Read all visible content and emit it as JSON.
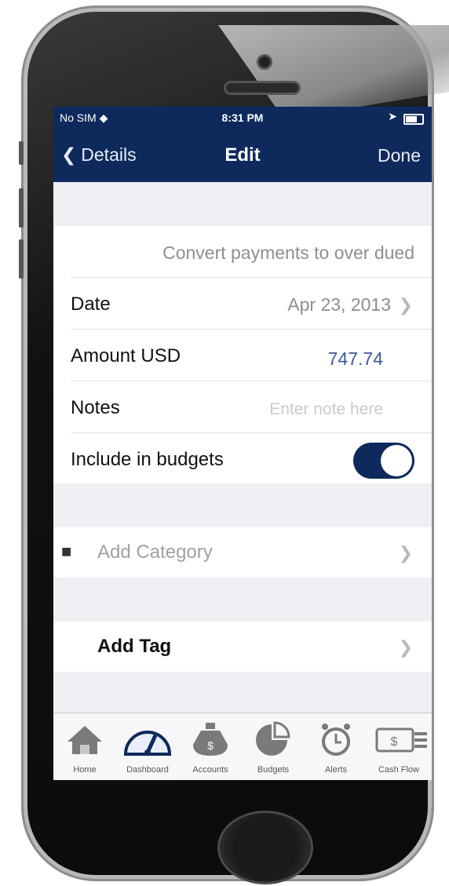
{
  "status_bar": {
    "carrier": "No SIM",
    "time": "8:31 PM"
  },
  "nav": {
    "back_label": "Details",
    "title": "Edit",
    "done_label": "Done"
  },
  "form": {
    "description": "Convert payments to over dued",
    "date_label": "Date",
    "date_value": "Apr 23, 2013",
    "amount_label": "Amount USD",
    "amount_value": "747.74",
    "notes_label": "Notes",
    "notes_placeholder": "Enter note here",
    "budgets_label": "Include in budgets",
    "budgets_on": true
  },
  "category": {
    "label": "Add Category"
  },
  "tag": {
    "label": "Add Tag"
  },
  "tabs": [
    {
      "label": "Home",
      "icon": "house-icon"
    },
    {
      "label": "Dashboard",
      "icon": "speedometer-icon"
    },
    {
      "label": "Accounts",
      "icon": "money-bag-icon"
    },
    {
      "label": "Budgets",
      "icon": "pie-chart-icon"
    },
    {
      "label": "Alerts",
      "icon": "alarm-clock-icon"
    },
    {
      "label": "Cash Flow",
      "icon": "cash-flow-icon"
    }
  ],
  "colors": {
    "nav_bg": "#0e2a5c",
    "accent_blue": "#3a5a9a"
  }
}
